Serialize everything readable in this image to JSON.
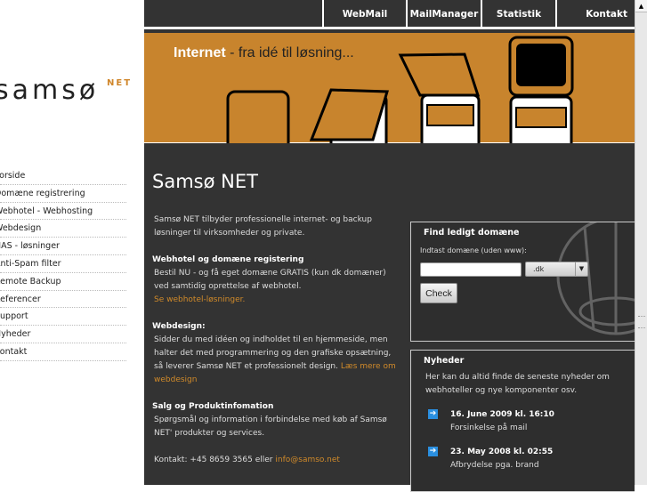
{
  "logo": {
    "text": "samsø",
    "suffix": "NET"
  },
  "menu": [
    "Forside",
    "Domæne registrering",
    "Webhotel - Webhosting",
    "Webdesign",
    "NAS - løsninger",
    "Anti-Spam filter",
    "Remote Backup",
    "Referencer",
    "Support",
    "Nyheder",
    "Kontakt"
  ],
  "nav": [
    "WebMail",
    "MailManager",
    "Statistik",
    "Kontakt"
  ],
  "banner": {
    "bold": "Internet",
    "rest": " - fra idé til løsning..."
  },
  "title": "Samsø NET",
  "content": {
    "intro": "Samsø NET tilbyder professionelle internet- og backup løsninger til virksomheder og private.",
    "s1_title": "Webhotel og domæne registering",
    "s1_text": "Bestil NU - og få eget domæne GRATIS (kun dk domæner) ved samtidig oprettelse af webhotel.",
    "s1_link": "Se webhotel-løsninger. ",
    "s2_title": "Webdesign:",
    "s2_text": "Sidder du med idéen og indholdet til en hjemmeside, men halter det med programmering og den grafiske opsætning, så leverer Samsø NET et professionelt design. ",
    "s2_link": "Læs mere om webdesign",
    "s3_title": "Salg og Produktinfomation",
    "s3_text": "Spørgsmål og information i forbindelse med køb af Samsø NET' produkter og services.",
    "contact": "Kontakt: +45 8659 3565 eller ",
    "email": "info@samso.net"
  },
  "domain": {
    "title": "Find ledigt domæne",
    "label": "Indtast domæne (uden www):",
    "value": "",
    "tld": ".dk",
    "button": "Check"
  },
  "news": {
    "title": "Nyheder",
    "intro": "Her kan du altid finde de seneste nyheder om webhoteller og nye komponenter osv.",
    "items": [
      {
        "date": "16. June 2009 kl. 16:10",
        "text": "Forsinkelse på mail"
      },
      {
        "date": "23. May 2008 kl. 02:55",
        "text": "Afbrydelse pga. brand"
      }
    ]
  }
}
